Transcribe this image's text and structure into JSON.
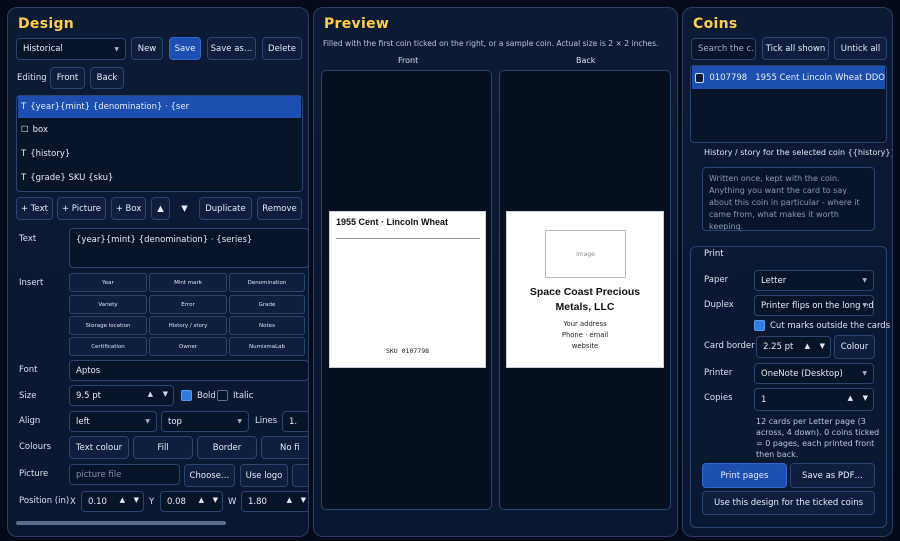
{
  "design": {
    "title": "Design",
    "template_select": "Historical",
    "new_label": "New",
    "save_label": "Save",
    "save_as_label": "Save as…",
    "delete_label": "Delete",
    "editing_label": "Editing",
    "front_tab": "Front",
    "back_tab": "Back",
    "elements": [
      {
        "prefix": "T",
        "text": "{year}{mint} {denomination}  ·  {ser"
      },
      {
        "prefix": "☐",
        "text": "box"
      },
      {
        "prefix": "T",
        "text": "{history}"
      },
      {
        "prefix": "T",
        "text": "{grade}  SKU {sku}"
      }
    ],
    "add_text": "+ Text",
    "add_picture": "+ Picture",
    "add_box": "+ Box",
    "up_label": "▲",
    "down_label": "▼",
    "duplicate_label": "Duplicate",
    "remove_label": "Remove",
    "text_label": "Text",
    "text_value": "{year}{mint} {denomination}  ·  {series}",
    "insert_label": "Insert",
    "insert_buttons": [
      "Year",
      "Mint mark",
      "Denomination",
      "Variety",
      "Error",
      "Grade",
      "Storage location",
      "History / story",
      "Notes",
      "Certification",
      "Owner",
      "NumismaLab"
    ],
    "font_label": "Font",
    "font_value": "Aptos",
    "size_label": "Size",
    "size_value": "9.5 pt",
    "bold_label": "Bold",
    "italic_label": "Italic",
    "align_label": "Align",
    "align_h": "left",
    "align_v": "top",
    "lines_label": "Lines",
    "lines_value": "1.",
    "colours_label": "Colours",
    "text_colour_label": "Text colour",
    "fill_label": "Fill",
    "border_label": "Border",
    "no_fill_label": "No fi",
    "picture_label": "Picture",
    "picture_placeholder": "picture file",
    "choose_label": "Choose…",
    "use_logo_label": "Use logo",
    "position_label": "Position (in)",
    "x_label": "X",
    "x_value": "0.10",
    "y_label": "Y",
    "y_value": "0.08",
    "w_label": "W",
    "w_value": "1.80"
  },
  "preview": {
    "title": "Preview",
    "subtitle": "Filled with the first coin ticked on the right, or a sample coin. Actual size is 2 × 2 inches.",
    "front_label": "Front",
    "back_label": "Back",
    "front_card": {
      "heading": "1955 Cent · Lincoln Wheat",
      "sku": "SKU 0107798"
    },
    "back_card": {
      "image_label": "image",
      "company": "Space Coast Precious Metals, LLC",
      "address": "Your address",
      "contact": "Phone · email",
      "website": "website"
    }
  },
  "coins": {
    "title": "Coins",
    "search_placeholder": "Search the c…",
    "tick_all": "Tick all shown",
    "untick_all": "Untick all",
    "list": [
      {
        "sku": "0107798",
        "name": "1955 Cent Lincoln Wheat DDO"
      }
    ],
    "history_label": "History / story for the selected coin  {{history}}",
    "history_placeholder": "Written once, kept with the coin. Anything you want the card to say about this coin in particular - where it came from, what makes it worth keeping.",
    "print": {
      "title": "Print",
      "paper_label": "Paper",
      "paper_value": "Letter",
      "duplex_label": "Duplex",
      "duplex_value": "Printer flips on the long edge",
      "cut_marks": "Cut marks outside the cards",
      "card_border_label": "Card border",
      "card_border_value": "2.25 pt",
      "colour_label": "Colour",
      "printer_label": "Printer",
      "printer_value": "OneNote (Desktop)",
      "copies_label": "Copies",
      "copies_value": "1",
      "summary": "12 cards per Letter page (3 across, 4 down). 0 coins ticked = 0 pages, each printed front then back.",
      "print_pages": "Print pages",
      "save_pdf": "Save as PDF…",
      "use_design": "Use this design for the ticked coins"
    }
  },
  "colors": {
    "accent": "#ffcf4a",
    "primary": "#1c4fb0",
    "background": "#050b18"
  }
}
